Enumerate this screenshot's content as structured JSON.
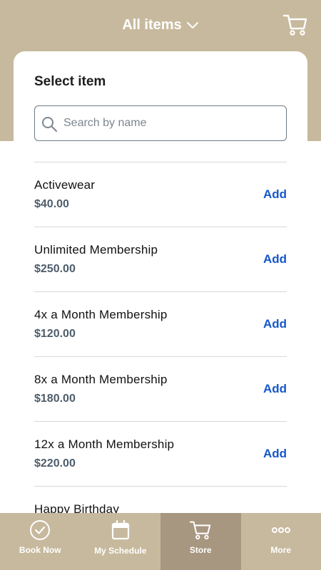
{
  "header": {
    "title": "All items",
    "dropdown_icon": "chevron-down-icon",
    "cart_icon": "cart-icon"
  },
  "panel": {
    "title": "Select item",
    "search": {
      "placeholder": "Search by name",
      "value": ""
    }
  },
  "items": [
    {
      "name": "Activewear",
      "price": "$40.00",
      "action": "Add"
    },
    {
      "name": "Unlimited Membership",
      "price": "$250.00",
      "action": "Add"
    },
    {
      "name": "4x a Month Membership",
      "price": "$120.00",
      "action": "Add"
    },
    {
      "name": "8x a Month Membership",
      "price": "$180.00",
      "action": "Add"
    },
    {
      "name": "12x a Month Membership",
      "price": "$220.00",
      "action": "Add"
    },
    {
      "name": "Happy Birthday",
      "price": "",
      "action": ""
    }
  ],
  "bottom_nav": [
    {
      "label": "Book Now",
      "icon": "check-circle-icon",
      "active": false
    },
    {
      "label": "My Schedule",
      "icon": "calendar-icon",
      "active": false
    },
    {
      "label": "Store",
      "icon": "cart-icon",
      "active": true
    },
    {
      "label": "More",
      "icon": "more-dots-icon",
      "active": false
    }
  ],
  "colors": {
    "brand": "#c7b99d",
    "active_tab": "#a79680",
    "link": "#1557c9",
    "price": "#4e5d6b"
  }
}
